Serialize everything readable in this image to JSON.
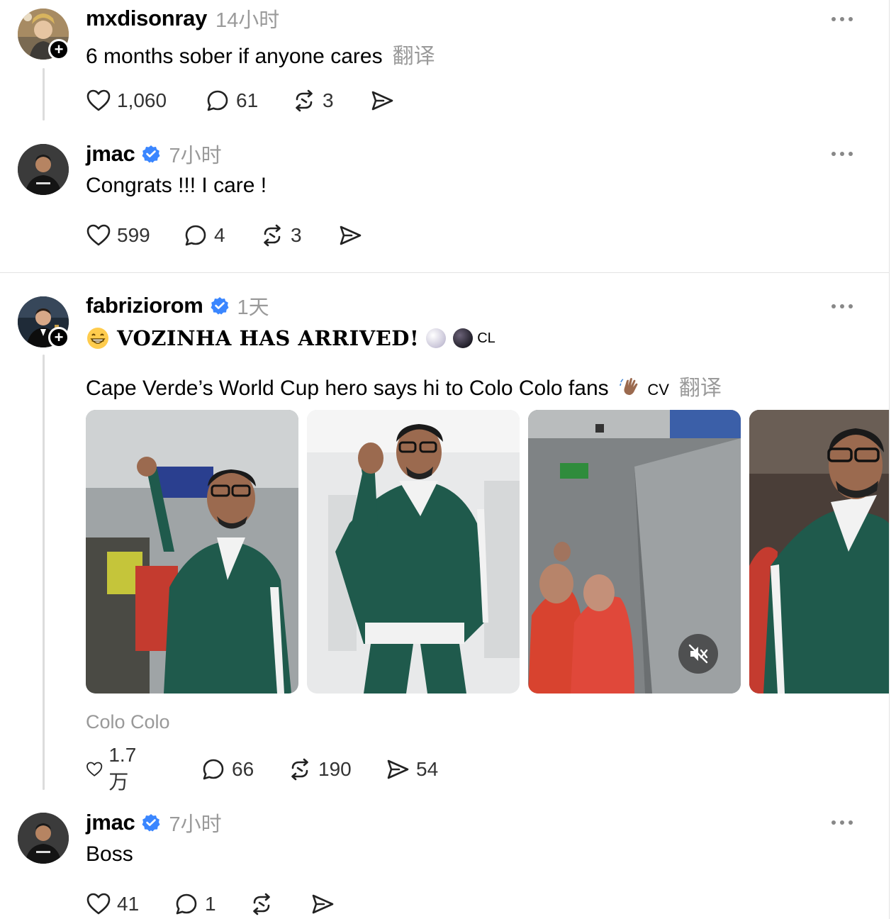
{
  "posts": [
    {
      "username": "mxdisonray",
      "time": "14小时",
      "text": "6 months sober if anyone cares",
      "translate": "翻译",
      "likes": "1,060",
      "replies": "61",
      "reposts": "3"
    },
    {
      "username": "jmac",
      "time": "7小时",
      "text": "Congrats !!! I care !",
      "likes": "599",
      "replies": "4",
      "reposts": "3"
    },
    {
      "username": "fabriziorom",
      "time": "1天",
      "headline": "VOZINHA HAS ARRIVED!",
      "headline_suffix": "CL",
      "text": "Cape Verde’s World Cup hero says hi to Colo Colo fans",
      "text_suffix": "CV",
      "translate": "翻译",
      "tag": "Colo Colo",
      "likes": "1.7 万",
      "replies": "66",
      "reposts": "190",
      "shares": "54"
    },
    {
      "username": "jmac",
      "time": "7小时",
      "text": "Boss",
      "likes": "41",
      "replies": "1"
    }
  ],
  "colors": {
    "verified": "#3a86ff",
    "muted_text": "#9a9a9a",
    "jacket_green": "#1f5a4c"
  },
  "icons": [
    "heart-icon",
    "comment-icon",
    "repost-icon",
    "share-icon",
    "more-icon",
    "verified-icon",
    "plus-icon",
    "mute-icon"
  ]
}
